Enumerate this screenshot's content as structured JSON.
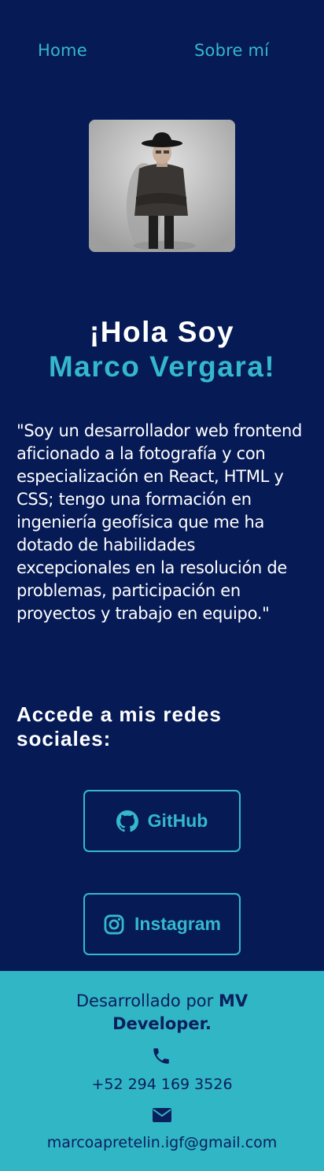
{
  "nav": {
    "home": "Home",
    "about": "Sobre mí"
  },
  "hero": {
    "greeting": "¡Hola Soy",
    "name": "Marco Vergara!"
  },
  "bio": "\"Soy un desarrollador web frontend aficionado a la fotografía y con especialización en React, HTML y CSS; tengo una formación en ingeniería geofísica que me ha dotado de habilidades excepcionales en la resolución de problemas, participación en proyectos y trabajo en equipo.\"",
  "social": {
    "title": "Accede a mis redes sociales:",
    "buttons": [
      {
        "label": "GitHub",
        "icon": "github-icon"
      },
      {
        "label": "Instagram",
        "icon": "instagram-icon"
      }
    ]
  },
  "footer": {
    "credit_prefix": "Desarrollado por ",
    "credit_brand": "MV Developer.",
    "phone": "+52 294 169 3526",
    "email": "marcoapretelin.igf@gmail.com"
  },
  "colors": {
    "background": "#061a55",
    "accent": "#35b8cc",
    "footer_bg": "#31b6c6",
    "footer_text": "#0b1f5c"
  }
}
